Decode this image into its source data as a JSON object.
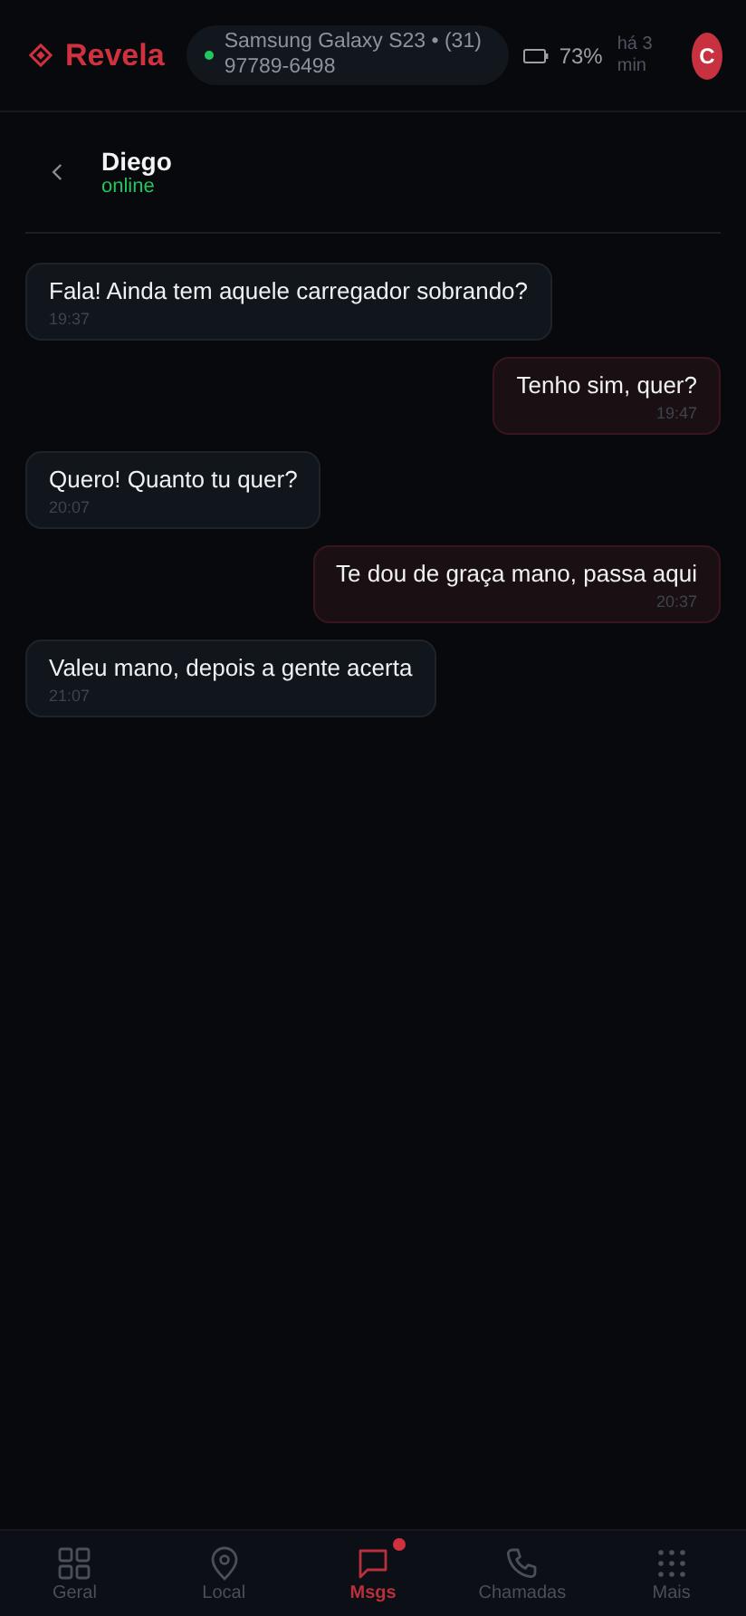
{
  "app": {
    "name": "Revela"
  },
  "device": {
    "label": "Samsung Galaxy S23 • (31) 97789-6498",
    "online": true,
    "battery": "73%",
    "updated": "há 3 min"
  },
  "user": {
    "initial": "C"
  },
  "chat": {
    "contact": "Diego",
    "status": "online"
  },
  "messages": [
    {
      "kind": "in",
      "text": "Fala! Ainda tem aquele carregador sobrando?",
      "time": "19:37"
    },
    {
      "kind": "out",
      "text": "Tenho sim, quer?",
      "time": "19:47"
    },
    {
      "kind": "in",
      "text": "Quero! Quanto tu quer?",
      "time": "20:07"
    },
    {
      "kind": "out",
      "text": "Te dou de graça mano, passa aqui",
      "time": "20:37"
    },
    {
      "kind": "in",
      "text": "Valeu mano, depois a gente acerta",
      "time": "21:07"
    }
  ],
  "nav": [
    {
      "kind": "grid",
      "label": "Geral",
      "selected": false,
      "badge": false
    },
    {
      "kind": "pin",
      "label": "Local",
      "selected": false,
      "badge": false
    },
    {
      "kind": "chat",
      "label": "Msgs",
      "selected": true,
      "badge": true
    },
    {
      "kind": "phone",
      "label": "Chamadas",
      "selected": false,
      "badge": false
    },
    {
      "kind": "dots",
      "label": "Mais",
      "selected": false,
      "badge": false
    }
  ]
}
